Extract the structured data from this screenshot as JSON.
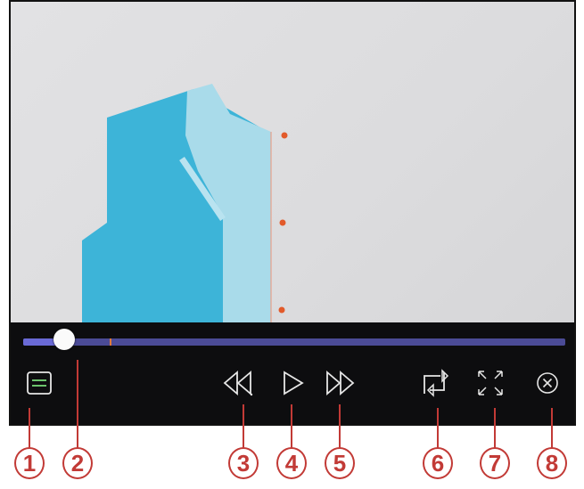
{
  "player": {
    "progress": 0.075,
    "buffered": 0.16,
    "colors": {
      "track": "#4b4b96",
      "played": "#6a6ad6",
      "thumb": "#fafafa",
      "icon": "#e6e6e6",
      "callout": "#c23a36",
      "pattern_dark": "#3db4d8",
      "pattern_light": "#a9dbea"
    },
    "buttons": [
      {
        "id": "menu",
        "icon": "menu-icon"
      },
      {
        "id": "rewind",
        "icon": "rewind-icon"
      },
      {
        "id": "play",
        "icon": "play-icon"
      },
      {
        "id": "fast_forward",
        "icon": "fast-forward-icon"
      },
      {
        "id": "repeat",
        "icon": "repeat-icon"
      },
      {
        "id": "fullscreen",
        "icon": "fullscreen-icon"
      },
      {
        "id": "close",
        "icon": "close-icon"
      }
    ]
  },
  "callouts": [
    "1",
    "2",
    "3",
    "4",
    "5",
    "6",
    "7",
    "8"
  ]
}
